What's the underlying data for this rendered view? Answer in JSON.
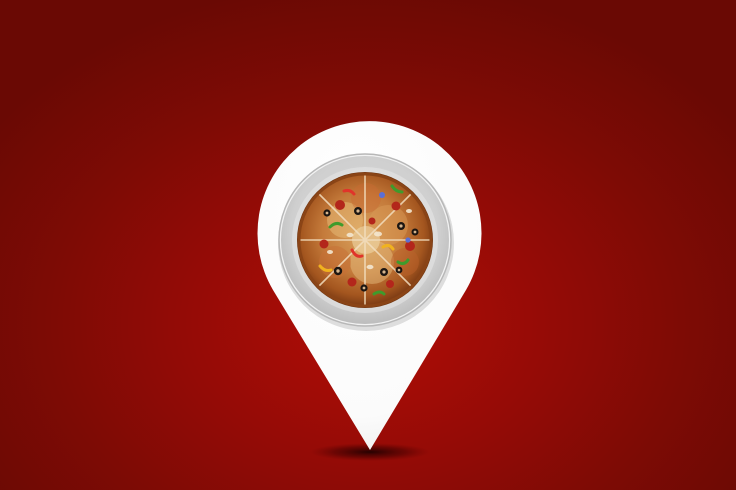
{
  "scene": {
    "background_color": "#8a0c06",
    "pin_color": "#ffffff",
    "plate_color": "#d9d9d9",
    "pin_icon": "map-location-pin-icon",
    "food_icon": "pizza-icon"
  }
}
